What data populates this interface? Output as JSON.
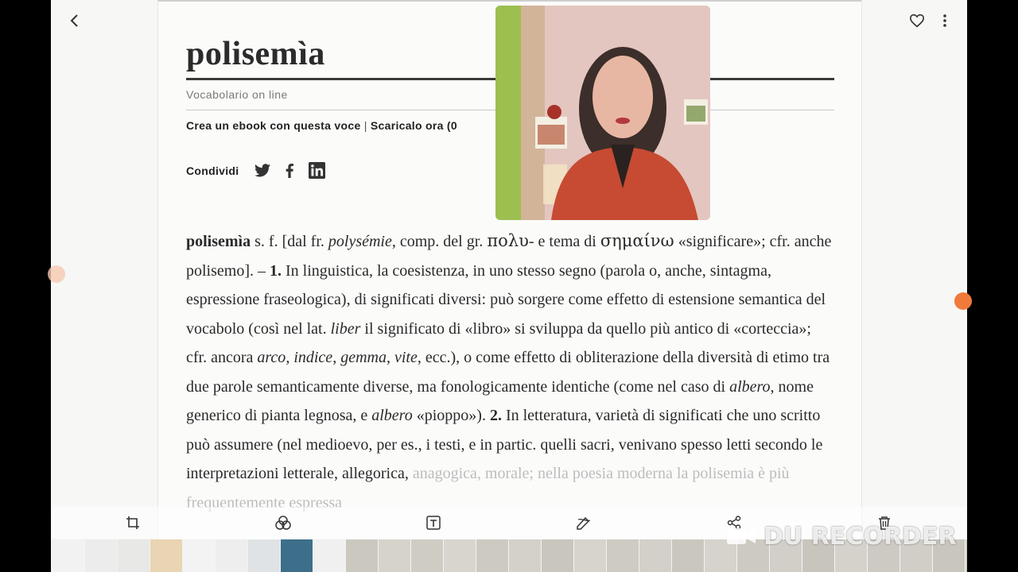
{
  "entry_title": "polisemìa",
  "subtitle": "Vocabolario on line",
  "ebook": {
    "create": "Crea un ebook con questa voce",
    "separator": "|",
    "download": "Scaricalo ora (0"
  },
  "share": {
    "label": "Condividi",
    "icons": [
      "twitter-icon",
      "facebook-icon",
      "linkedin-icon"
    ]
  },
  "definition": {
    "headword": "polisemìa",
    "t1": " s. f. [dal fr. ",
    "i1": "polysémie",
    "t2": ", comp. del gr. ",
    "greek1": "πολυ",
    "t3": "- e tema di ",
    "greek2": "σημαίνω",
    "t4": " «significare»; cfr. anche polisemo]. – ",
    "n1": "1.",
    "t5": " In linguistica, la coesistenza, in uno stesso segno (parola o, anche, sintagma, espressione fraseologica), di significati diversi: può sorgere come effetto di estensione semantica del vocabolo (così nel lat. ",
    "i2": "liber",
    "t6": " il significato di «libro» si sviluppa da quello più antico di «corteccia»; cfr. ancora ",
    "i3": "arco",
    "t7": ", ",
    "i4": "indice",
    "t8": ", ",
    "i5": "gemma",
    "t9": ", ",
    "i6": "vite",
    "t10": ", ecc.), o come effetto di obliterazione della diversità di etimo tra due parole semanticamente diverse, ma fonologicamente identiche (come nel caso di ",
    "i7": "albero",
    "t11": ", nome generico di pianta legnosa, e ",
    "i8": "albero",
    "t12": " «pioppo»). ",
    "n2": "2.",
    "t13": " In letteratura, varietà di significati che uno scritto può assumere (nel medioevo, per es., i testi, e in partic. quelli sacri, venivano spesso letti secondo le interpretazioni letterale, allegorica, ",
    "t14": "anagogica, morale; nella poesia moderna la polisemia è più frequentemente espressa"
  },
  "watermark": "DU RECORDER",
  "colors": {
    "text": "#2a2a2a",
    "page_bg": "#fbfbfa",
    "rule": "#3a3a3a",
    "muted": "#7a7a7a",
    "recorder_dot": "#f07a3a"
  }
}
